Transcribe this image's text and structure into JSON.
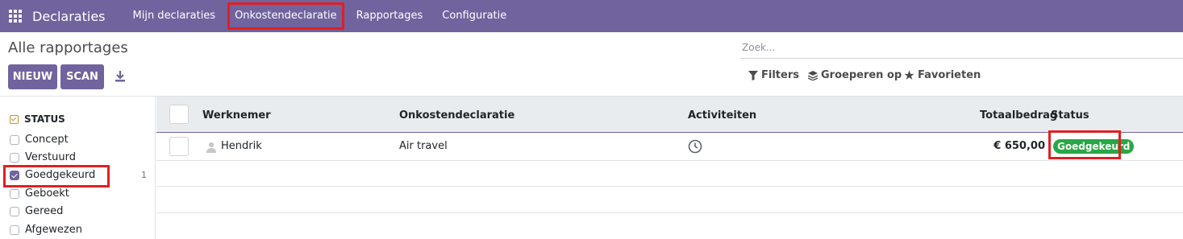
{
  "navbar": {
    "brand": "Declaraties",
    "items": [
      {
        "label": "Mijn declaraties"
      },
      {
        "label": "Onkostendeclaratie"
      },
      {
        "label": "Rapportages"
      },
      {
        "label": "Configuratie"
      }
    ]
  },
  "control_panel": {
    "title": "Alle rapportages",
    "new_label": "NIEUW",
    "scan_label": "SCAN",
    "search_placeholder": "Zoek...",
    "filters_label": "Filters",
    "group_label": "Groeperen op",
    "favorites_label": "Favorieten"
  },
  "sidebar": {
    "header": "STATUS",
    "items": [
      {
        "label": "Concept",
        "checked": false,
        "count": ""
      },
      {
        "label": "Verstuurd",
        "checked": false,
        "count": ""
      },
      {
        "label": "Goedgekeurd",
        "checked": true,
        "count": "1"
      },
      {
        "label": "Geboekt",
        "checked": false,
        "count": ""
      },
      {
        "label": "Gereed",
        "checked": false,
        "count": ""
      },
      {
        "label": "Afgewezen",
        "checked": false,
        "count": ""
      }
    ]
  },
  "table": {
    "columns": {
      "employee": "Werknemer",
      "expense": "Onkostendeclaratie",
      "activities": "Activiteiten",
      "total": "Totaalbedrag",
      "status": "Status"
    },
    "rows": [
      {
        "employee": "Hendrik",
        "expense": "Air travel",
        "total": "€ 650,00",
        "status": "Goedgekeurd"
      }
    ]
  },
  "colors": {
    "brand": "#71639e",
    "status_approved": "#28a745",
    "highlight": "#e02020"
  }
}
